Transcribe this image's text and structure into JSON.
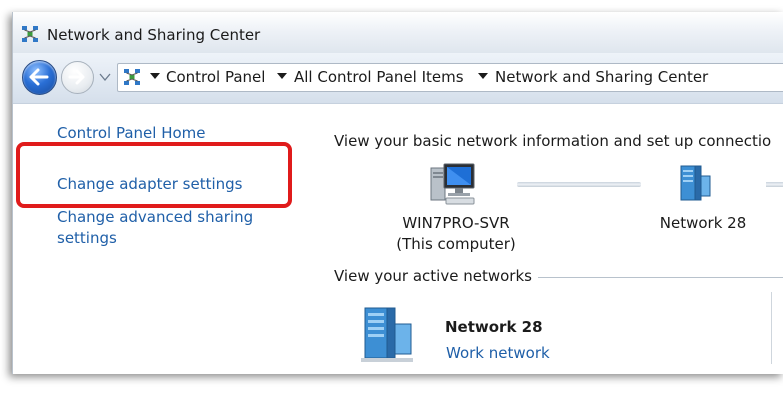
{
  "window": {
    "title": "Network and Sharing Center"
  },
  "addressbar": {
    "crumbs": [
      "Control Panel",
      "All Control Panel Items",
      "Network and Sharing Center"
    ]
  },
  "sidebar": {
    "links": [
      {
        "label": "Control Panel Home"
      },
      {
        "label": "Change adapter settings"
      },
      {
        "label_line1": "Change advanced sharing",
        "label_line2": "settings"
      }
    ]
  },
  "main": {
    "heading": "View your basic network information and set up connectio",
    "map": {
      "computer_name": "WIN7PRO-SVR",
      "computer_sub": "(This computer)",
      "network_name": "Network  28"
    },
    "active_title": "View your active networks",
    "active_network": {
      "name": "Network  28",
      "type": "Work network"
    }
  },
  "colors": {
    "link": "#1f5fa8",
    "highlight": "#e01b1b",
    "text": "#1b1b1b"
  }
}
